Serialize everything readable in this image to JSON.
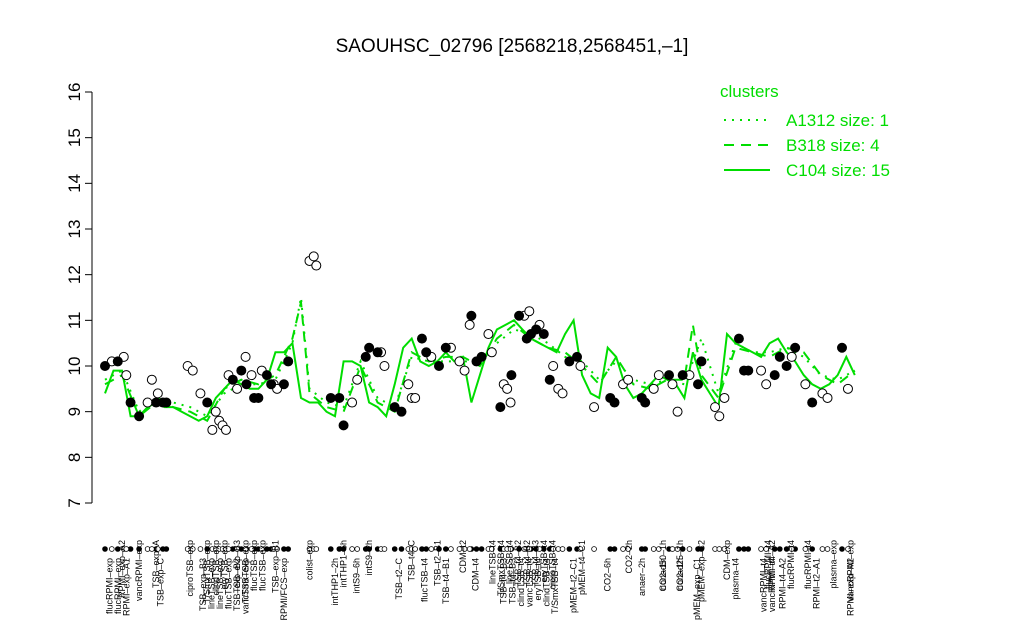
{
  "chart_data": {
    "type": "line",
    "title": "SAOUHSC_02796 [2568218,2568451,–1]",
    "xlabel": "",
    "ylabel": "",
    "ylim": [
      7,
      16
    ],
    "yticks": [
      "7",
      "8",
      "9",
      "10",
      "11",
      "12",
      "13",
      "14",
      "15",
      "16"
    ],
    "xlim": [
      0,
      100
    ],
    "legend": {
      "title": "clusters",
      "placement": "top-right",
      "entries": [
        {
          "label": "A1312 size: 1",
          "style": "dotted"
        },
        {
          "label": "B318 size: 4",
          "style": "dashed"
        },
        {
          "label": "C104 size: 15",
          "style": "solid"
        }
      ]
    },
    "line_color": "#00dd00",
    "grid": false,
    "x_labels_top": [
      {
        "x": 2,
        "label": "RPMI–exp–A2"
      },
      {
        "x": 4,
        "label": "vancRPMI–exp"
      },
      {
        "x": 6,
        "label": "TSB–exp–A"
      },
      {
        "x": 10,
        "label": "ciproTSB–exp"
      },
      {
        "x": 12,
        "label": "T/SmxTSB–exp"
      },
      {
        "x": 13,
        "label": "clindTSB–exp"
      },
      {
        "x": 14,
        "label": "eryTSB–exp"
      },
      {
        "x": 15.5,
        "label": "TSB–exp–B3"
      },
      {
        "x": 16.5,
        "label": "T/SmxTSB–exp"
      },
      {
        "x": 17.5,
        "label": "flucTSB–exp"
      },
      {
        "x": 18.5,
        "label": "flucTSB–exp"
      },
      {
        "x": 20,
        "label": "TSB–exp–B1"
      },
      {
        "x": 24,
        "label": "colist–exp"
      },
      {
        "x": 28,
        "label": "intTHP1–6h"
      },
      {
        "x": 31,
        "label": "intS9–2h"
      },
      {
        "x": 36,
        "label": "TSB–t4–C"
      },
      {
        "x": 39,
        "label": "TSB–t2–B1"
      },
      {
        "x": 42,
        "label": "CDM–t2"
      },
      {
        "x": 45.5,
        "label": "lineTSB–t4"
      },
      {
        "x": 46.5,
        "label": "T/SmxTSB–t4"
      },
      {
        "x": 47.5,
        "label": "lineTSB–t4"
      },
      {
        "x": 48.5,
        "label": "TSB–t4–B2"
      },
      {
        "x": 49.5,
        "label": "TSB–t4–B2"
      },
      {
        "x": 50.5,
        "label": "TSB–t4–B3"
      },
      {
        "x": 51.5,
        "label": "eryTSB–t4"
      },
      {
        "x": 52.5,
        "label": "ciproTSB–t4"
      },
      {
        "x": 56,
        "label": "pMEM–t4–C1"
      },
      {
        "x": 61.5,
        "label": "CO2–2h"
      },
      {
        "x": 65.5,
        "label": "nonad50–1h"
      },
      {
        "x": 67.5,
        "label": "nonad25–1h"
      },
      {
        "x": 70,
        "label": "pMEM–exp–C2"
      },
      {
        "x": 73,
        "label": "CDM–exp"
      },
      {
        "x": 77.8,
        "label": "flucRPMI–t4"
      },
      {
        "x": 78.3,
        "label": "RPMI–t4–A2"
      },
      {
        "x": 80.5,
        "label": "flucRPMI–t4"
      },
      {
        "x": 82.5,
        "label": "flucRPMI–t4"
      },
      {
        "x": 85.5,
        "label": "plasma–exp"
      },
      {
        "x": 87.5,
        "label": "vancRPMI–exp"
      }
    ],
    "x_labels_bottom": [
      {
        "x": 0.5,
        "label": "flucRPMI–exp"
      },
      {
        "x": 1.5,
        "label": "flucRPMI–exp"
      },
      {
        "x": 2.5,
        "label": "RPMI–exp–A1"
      },
      {
        "x": 6.5,
        "label": "TSB–exp–C"
      },
      {
        "x": 11.5,
        "label": "TSB–exp–B3"
      },
      {
        "x": 12.5,
        "label": "lineTSB–exp"
      },
      {
        "x": 13.5,
        "label": "lineTSB–exp"
      },
      {
        "x": 14.5,
        "label": "flucTSB–exp"
      },
      {
        "x": 15.5,
        "label": "TSB–exp–B2"
      },
      {
        "x": 16.5,
        "label": "vancTSB–exp"
      },
      {
        "x": 21,
        "label": "RPMI/FCS–exp"
      },
      {
        "x": 27,
        "label": "intTHP1–2h"
      },
      {
        "x": 29.5,
        "label": "intS9–6h"
      },
      {
        "x": 34.5,
        "label": "TSB–t2–C"
      },
      {
        "x": 37.5,
        "label": "flucTSB–t4"
      },
      {
        "x": 40,
        "label": "TSB–t4–B1"
      },
      {
        "x": 43.5,
        "label": "CDM–t4"
      },
      {
        "x": 46.8,
        "label": "TSB–t4–B3"
      },
      {
        "x": 47.8,
        "label": "TSB–t4–B3"
      },
      {
        "x": 48.8,
        "label": "clindTSB–t4"
      },
      {
        "x": 49.8,
        "label": "vancTSB–t4"
      },
      {
        "x": 50.8,
        "label": "eryTSB–t4"
      },
      {
        "x": 51.8,
        "label": "clindTSB–t4"
      },
      {
        "x": 52.8,
        "label": "T/SmxTSB–t4"
      },
      {
        "x": 55,
        "label": "pMEM–t2–C1"
      },
      {
        "x": 59,
        "label": "CO2–6h"
      },
      {
        "x": 63,
        "label": "anaer–2h"
      },
      {
        "x": 65.5,
        "label": "CO2–1h"
      },
      {
        "x": 67.5,
        "label": "CO2–1h"
      },
      {
        "x": 69.5,
        "label": "pMEM–exp–C1"
      },
      {
        "x": 74,
        "label": "plasma–t4"
      },
      {
        "x": 77.3,
        "label": "vancRPMI–t4"
      },
      {
        "x": 78.3,
        "label": "vancRPMI–t4"
      },
      {
        "x": 79.5,
        "label": "RPMI–t4–A2"
      },
      {
        "x": 83.5,
        "label": "RPMI–t2–A1"
      },
      {
        "x": 87.5,
        "label": "RPMI–exp–A2"
      }
    ],
    "series": [
      {
        "style": "solid",
        "x": [
          0,
          1,
          2,
          3,
          4,
          5,
          6,
          7,
          8,
          9,
          10,
          11,
          12,
          13,
          14,
          15,
          16,
          17,
          18,
          19,
          20,
          21,
          22,
          23,
          24,
          25,
          26,
          27,
          28,
          29,
          30,
          31,
          32,
          33,
          34,
          35,
          36,
          37,
          38,
          39,
          40,
          41,
          42,
          43,
          44,
          45,
          46,
          47,
          48,
          49,
          50,
          51,
          52,
          53,
          54,
          55,
          56,
          57,
          58,
          59,
          60,
          61,
          62,
          63,
          64,
          65,
          66,
          67,
          68,
          69,
          70,
          71,
          72,
          73,
          74,
          75,
          76,
          77,
          78,
          79,
          80,
          81,
          82,
          83,
          84,
          85,
          86,
          87,
          88
        ],
        "y": [
          9.4,
          9.9,
          9.9,
          8.9,
          8.9,
          9.1,
          9.2,
          9.1,
          9.1,
          9.0,
          8.9,
          8.8,
          8.9,
          9.3,
          9.5,
          9.7,
          9.6,
          9.5,
          9.5,
          9.7,
          10.3,
          10.3,
          10.5,
          9.3,
          9.2,
          9.2,
          9.0,
          8.9,
          10.1,
          10.1,
          10.0,
          9.2,
          9.1,
          8.9,
          9.6,
          10.4,
          10.6,
          10.1,
          10.0,
          10.1,
          10.3,
          10.1,
          10.2,
          9.2,
          9.8,
          10.4,
          10.8,
          10.9,
          11.0,
          10.8,
          10.6,
          10.5,
          10.4,
          10.3,
          10.7,
          11.0,
          9.8,
          9.4,
          9.3,
          10.4,
          10.2,
          9.6,
          9.3,
          9.4,
          9.6,
          9.8,
          9.7,
          9.6,
          9.3,
          10.3,
          9.7,
          9.4,
          9.1,
          10.7,
          10.5,
          10.4,
          10.3,
          10.2,
          10.5,
          10.6,
          10.3,
          10.1,
          9.8,
          9.6,
          9.5,
          9.6,
          9.8,
          10.2,
          9.8
        ]
      },
      {
        "style": "dashed",
        "x": [
          0,
          2,
          4,
          6,
          8,
          10,
          12,
          14,
          16,
          18,
          20,
          22,
          23,
          24,
          26,
          28,
          30,
          32,
          34,
          36,
          38,
          40,
          42,
          44,
          46,
          48,
          50,
          52,
          54,
          56,
          58,
          60,
          62,
          64,
          66,
          68,
          69,
          70,
          72,
          74,
          76,
          78,
          80,
          82,
          84,
          86,
          88
        ],
        "y": [
          9.6,
          9.8,
          8.9,
          9.2,
          9.1,
          9.0,
          8.8,
          9.5,
          9.7,
          9.6,
          9.8,
          10.6,
          11.4,
          9.4,
          9.1,
          9.0,
          10.0,
          9.2,
          9.0,
          10.3,
          10.1,
          10.2,
          10.2,
          10.0,
          10.6,
          10.9,
          10.6,
          10.4,
          10.3,
          10.0,
          9.6,
          10.2,
          9.6,
          9.5,
          9.7,
          9.7,
          10.9,
          9.8,
          9.3,
          10.4,
          10.3,
          10.2,
          10.4,
          10.3,
          9.8,
          9.6,
          9.9
        ]
      },
      {
        "style": "dotted",
        "x": [
          0,
          2,
          4,
          6,
          8,
          10,
          12,
          14,
          16,
          18,
          20,
          22,
          23,
          24,
          26,
          28,
          30,
          32,
          34,
          36,
          38,
          40,
          42,
          44,
          46,
          48,
          50,
          52,
          54,
          56,
          58,
          60,
          62,
          64,
          66,
          68,
          70,
          72,
          74,
          76,
          78,
          80,
          82,
          84,
          86,
          88
        ],
        "y": [
          9.7,
          9.9,
          9.0,
          9.3,
          9.2,
          9.1,
          8.9,
          9.4,
          9.6,
          9.6,
          9.7,
          10.5,
          11.5,
          9.5,
          9.2,
          9.1,
          10.1,
          9.3,
          9.1,
          10.2,
          10.1,
          10.1,
          10.1,
          10.1,
          10.5,
          10.8,
          10.7,
          10.5,
          10.2,
          10.1,
          9.7,
          10.1,
          9.7,
          9.6,
          9.7,
          9.6,
          10.6,
          9.4,
          10.5,
          10.3,
          10.3,
          10.4,
          10.2,
          9.8,
          9.7,
          9.9
        ]
      }
    ],
    "points_filled": [
      [
        0,
        10.0
      ],
      [
        1.5,
        10.1
      ],
      [
        3,
        9.2
      ],
      [
        4,
        8.9
      ],
      [
        6,
        9.2
      ],
      [
        6.8,
        9.2
      ],
      [
        7.2,
        9.2
      ],
      [
        12,
        9.2
      ],
      [
        15,
        9.7
      ],
      [
        16,
        9.9
      ],
      [
        16.6,
        9.6
      ],
      [
        17.5,
        9.3
      ],
      [
        18,
        9.3
      ],
      [
        19.5,
        9.6
      ],
      [
        19,
        9.8
      ],
      [
        21,
        9.6
      ],
      [
        21.5,
        10.1
      ],
      [
        26.5,
        9.3
      ],
      [
        27.5,
        9.3
      ],
      [
        28,
        8.7
      ],
      [
        30.6,
        10.2
      ],
      [
        31,
        10.4
      ],
      [
        32,
        10.3
      ],
      [
        34,
        9.1
      ],
      [
        34.8,
        9.0
      ],
      [
        37.2,
        10.6
      ],
      [
        37.7,
        10.3
      ],
      [
        39.2,
        10.0
      ],
      [
        40,
        10.4
      ],
      [
        43,
        11.1
      ],
      [
        43.6,
        10.1
      ],
      [
        44.2,
        10.2
      ],
      [
        46.4,
        9.1
      ],
      [
        47.7,
        9.8
      ],
      [
        48.6,
        11.1
      ],
      [
        49.5,
        10.6
      ],
      [
        50,
        10.7
      ],
      [
        50.6,
        10.8
      ],
      [
        51.5,
        10.7
      ],
      [
        52.2,
        9.7
      ],
      [
        54.5,
        10.1
      ],
      [
        55.4,
        10.2
      ],
      [
        59.3,
        9.3
      ],
      [
        59.8,
        9.2
      ],
      [
        63,
        9.3
      ],
      [
        63.4,
        9.2
      ],
      [
        66.2,
        9.8
      ],
      [
        67.8,
        9.8
      ],
      [
        69.6,
        9.6
      ],
      [
        70,
        10.1
      ],
      [
        74.4,
        10.6
      ],
      [
        75,
        9.9
      ],
      [
        75.5,
        9.9
      ],
      [
        78.6,
        9.8
      ],
      [
        79.2,
        10.2
      ],
      [
        80,
        10.0
      ],
      [
        81,
        10.4
      ],
      [
        83,
        9.2
      ],
      [
        86.5,
        10.4
      ]
    ],
    "points_open": [
      [
        0.8,
        10.1
      ],
      [
        2.2,
        10.2
      ],
      [
        2.5,
        9.8
      ],
      [
        5,
        9.2
      ],
      [
        5.5,
        9.7
      ],
      [
        6.2,
        9.4
      ],
      [
        9.7,
        10.0
      ],
      [
        10.3,
        9.9
      ],
      [
        11.2,
        9.4
      ],
      [
        12.6,
        8.6
      ],
      [
        13,
        9.0
      ],
      [
        13.4,
        8.8
      ],
      [
        13.8,
        8.7
      ],
      [
        14.2,
        8.6
      ],
      [
        14.5,
        9.8
      ],
      [
        15.5,
        9.5
      ],
      [
        16.5,
        10.2
      ],
      [
        17.2,
        9.8
      ],
      [
        18.4,
        9.9
      ],
      [
        19.8,
        9.6
      ],
      [
        20.2,
        9.5
      ],
      [
        24,
        12.3
      ],
      [
        24.5,
        12.4
      ],
      [
        24.8,
        12.2
      ],
      [
        29,
        9.2
      ],
      [
        29.6,
        9.7
      ],
      [
        32.4,
        10.3
      ],
      [
        32.8,
        10.0
      ],
      [
        35.6,
        9.6
      ],
      [
        36,
        9.3
      ],
      [
        36.4,
        9.3
      ],
      [
        38.3,
        10.2
      ],
      [
        40.6,
        10.4
      ],
      [
        41.6,
        10.1
      ],
      [
        42.2,
        9.9
      ],
      [
        42.8,
        10.9
      ],
      [
        45,
        10.7
      ],
      [
        45.4,
        10.3
      ],
      [
        46.8,
        9.6
      ],
      [
        47.2,
        9.5
      ],
      [
        47.6,
        9.2
      ],
      [
        49.2,
        11.1
      ],
      [
        49.8,
        11.2
      ],
      [
        51,
        10.9
      ],
      [
        52.6,
        10.0
      ],
      [
        53.2,
        9.5
      ],
      [
        53.7,
        9.4
      ],
      [
        55.8,
        10.0
      ],
      [
        57.4,
        9.1
      ],
      [
        60.8,
        9.6
      ],
      [
        61.4,
        9.7
      ],
      [
        64.4,
        9.5
      ],
      [
        65,
        9.8
      ],
      [
        66.6,
        9.6
      ],
      [
        67.2,
        9.0
      ],
      [
        68.6,
        9.8
      ],
      [
        71.6,
        9.1
      ],
      [
        72.1,
        8.9
      ],
      [
        72.7,
        9.3
      ],
      [
        77,
        9.9
      ],
      [
        77.6,
        9.6
      ],
      [
        80.6,
        10.2
      ],
      [
        82.2,
        9.6
      ],
      [
        84.2,
        9.4
      ],
      [
        84.8,
        9.3
      ],
      [
        87.2,
        9.5
      ]
    ]
  }
}
